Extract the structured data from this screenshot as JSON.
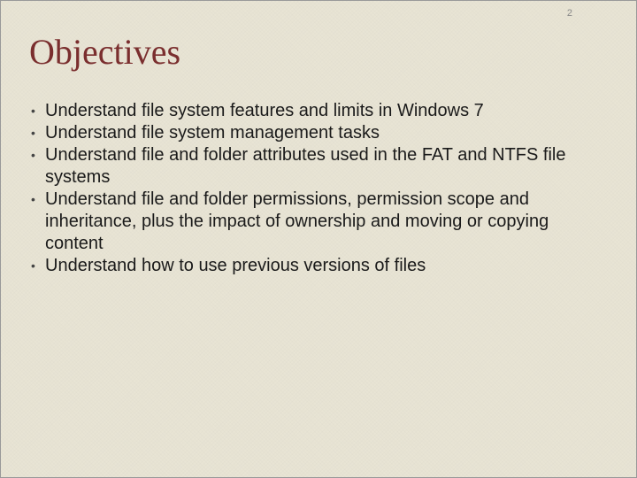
{
  "page_number": "2",
  "title": "Objectives",
  "bullets": [
    "Understand file system features and limits in Windows 7",
    "Understand file system management tasks",
    "Understand file and folder attributes used in the FAT and NTFS file systems",
    "Understand file and folder permissions, permission scope and inheritance, plus the impact of ownership and moving or copying content",
    "Understand how to use previous versions of files"
  ]
}
